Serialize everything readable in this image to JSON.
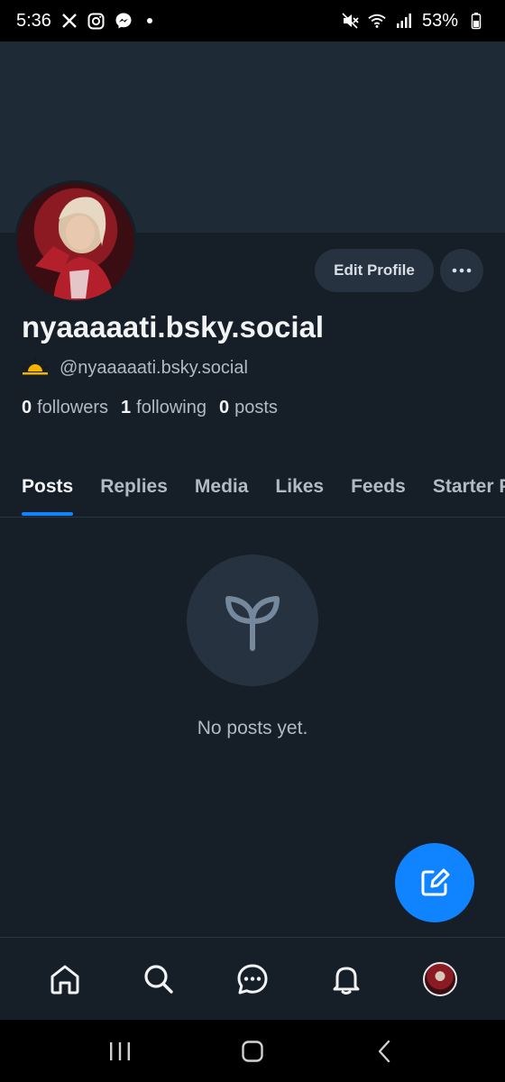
{
  "status_bar": {
    "time": "5:36",
    "battery": "53%",
    "left_icons": [
      "x-icon",
      "instagram-icon",
      "messenger-icon"
    ],
    "right_icons": [
      "mute-icon",
      "wifi-icon",
      "signal-icon",
      "battery-icon"
    ]
  },
  "profile": {
    "display_name": "nyaaaaati.bsky.social",
    "handle": "@nyaaaaati.bsky.social",
    "handle_emoji": "sunrise-icon",
    "edit_label": "Edit Profile",
    "stats": {
      "followers_count": "0",
      "followers_label": "followers",
      "following_count": "1",
      "following_label": "following",
      "posts_count": "0",
      "posts_label": "posts"
    }
  },
  "tabs": [
    {
      "label": "Posts",
      "active": true
    },
    {
      "label": "Replies"
    },
    {
      "label": "Media"
    },
    {
      "label": "Likes"
    },
    {
      "label": "Feeds"
    },
    {
      "label": "Starter Packs"
    }
  ],
  "empty_state": {
    "message": "No posts yet.",
    "icon": "sprout-icon"
  },
  "bottom_nav": [
    "home-icon",
    "search-icon",
    "chat-icon",
    "bell-icon",
    "profile-avatar"
  ],
  "colors": {
    "background": "#161e27",
    "banner": "#1e2a36",
    "accent": "#1083fe",
    "button_bg": "#26323f",
    "muted_text": "#b1bac5"
  }
}
